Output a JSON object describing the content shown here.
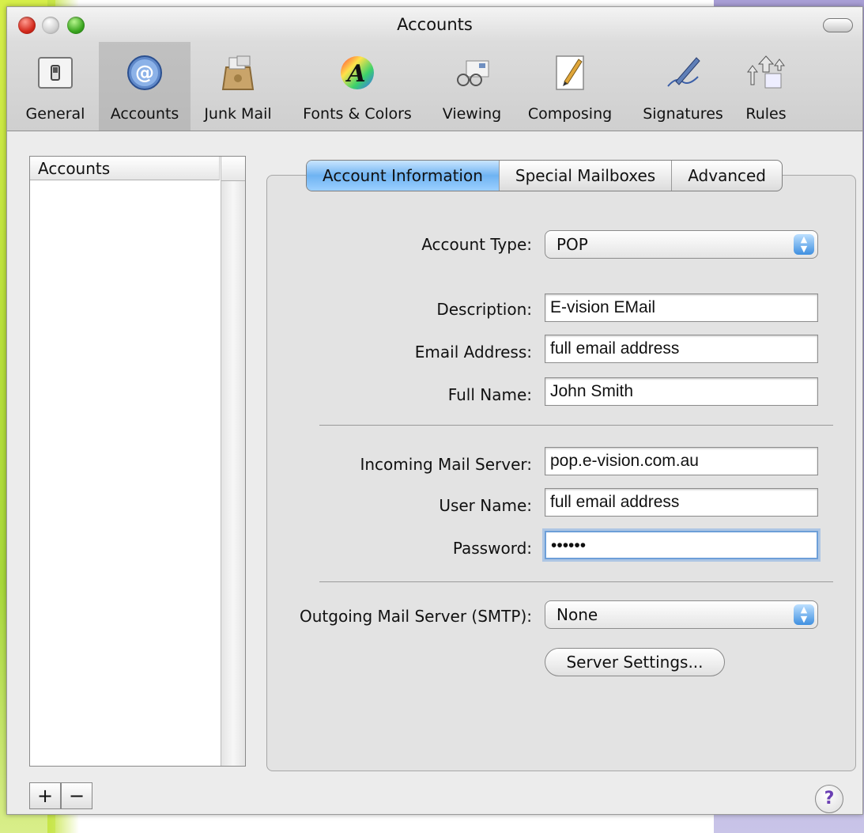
{
  "window": {
    "title": "Accounts"
  },
  "toolbar": {
    "items": [
      {
        "label": "General",
        "icon": "general-switch-icon"
      },
      {
        "label": "Accounts",
        "icon": "at-sign-icon"
      },
      {
        "label": "Junk Mail",
        "icon": "junk-bag-icon"
      },
      {
        "label": "Fonts & Colors",
        "icon": "font-color-wheel-icon"
      },
      {
        "label": "Viewing",
        "icon": "glasses-icon"
      },
      {
        "label": "Composing",
        "icon": "pencil-paper-icon"
      },
      {
        "label": "Signatures",
        "icon": "pen-signature-icon"
      },
      {
        "label": "Rules",
        "icon": "arrows-rules-icon"
      }
    ],
    "selected": "Accounts"
  },
  "accounts_list": {
    "header": "Accounts",
    "items": []
  },
  "list_buttons": {
    "add": "+",
    "remove": "−"
  },
  "tabs": [
    {
      "label": "Account Information"
    },
    {
      "label": "Special Mailboxes"
    },
    {
      "label": "Advanced"
    }
  ],
  "selected_tab": "Account Information",
  "form": {
    "account_type_label": "Account Type:",
    "account_type_value": "POP",
    "description_label": "Description:",
    "description_value": "E-vision EMail",
    "email_label": "Email Address:",
    "email_value": "full email address",
    "fullname_label": "Full Name:",
    "fullname_value": "John Smith",
    "incoming_label": "Incoming Mail Server:",
    "incoming_value": "pop.e-vision.com.au",
    "username_label": "User Name:",
    "username_value": "full email address",
    "password_label": "Password:",
    "password_value": "••••••",
    "smtp_label": "Outgoing Mail Server (SMTP):",
    "smtp_value": "None",
    "server_settings_label": "Server Settings..."
  },
  "help": {
    "label": "?"
  },
  "colors": {
    "accent": "#6fb3f2",
    "help": "#6a3fb3"
  }
}
